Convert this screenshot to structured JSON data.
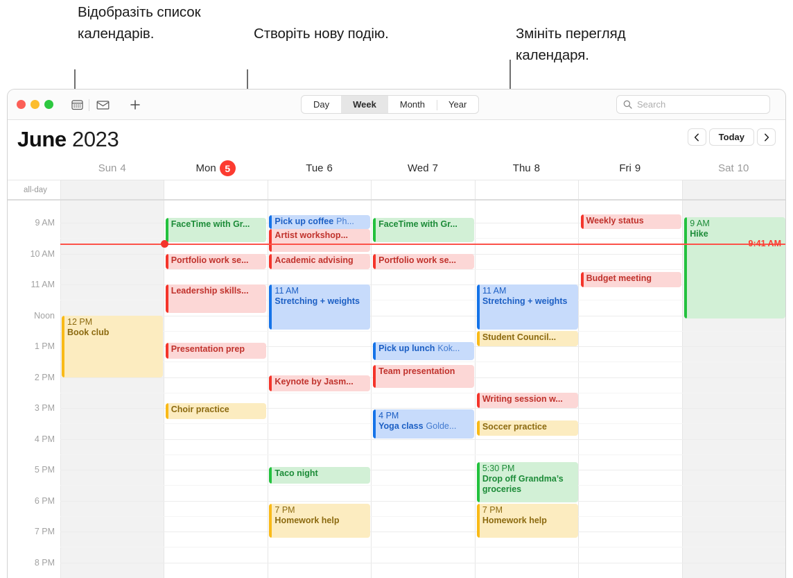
{
  "callouts": [
    {
      "id": "show-calendar-list",
      "text": "Відобразіть список календарів."
    },
    {
      "id": "create-new-event",
      "text": "Створіть нову подію."
    },
    {
      "id": "change-calendar-view",
      "text": "Змініть перегляд календаря."
    }
  ],
  "window": {
    "traffic_lights": [
      "close",
      "minimize",
      "zoom"
    ],
    "toolbar": {
      "calendar_list_icon": "calendar-icon",
      "inbox_icon": "inbox-icon",
      "new_event_icon": "plus-icon",
      "view_segments": [
        {
          "label": "Day",
          "active": false
        },
        {
          "label": "Week",
          "active": true
        },
        {
          "label": "Month",
          "active": false
        },
        {
          "label": "Year",
          "active": false
        }
      ],
      "search": {
        "icon": "search-icon",
        "placeholder": "Search",
        "value": ""
      }
    },
    "title": {
      "month": "June",
      "year": "2023"
    },
    "navigation": {
      "prev": "‹",
      "today": "Today",
      "next": "›"
    },
    "all_day_label": "all-day",
    "days": [
      {
        "weekday": "Sun",
        "date": "4",
        "today": false,
        "weekend": true
      },
      {
        "weekday": "Mon",
        "date": "5",
        "today": true,
        "weekend": false
      },
      {
        "weekday": "Tue",
        "date": "6",
        "today": false,
        "weekend": false
      },
      {
        "weekday": "Wed",
        "date": "7",
        "today": false,
        "weekend": false
      },
      {
        "weekday": "Thu",
        "date": "8",
        "today": false,
        "weekend": false
      },
      {
        "weekday": "Fri",
        "date": "9",
        "today": false,
        "weekend": false
      },
      {
        "weekday": "Sat",
        "date": "10",
        "today": false,
        "weekend": true
      }
    ],
    "time_labels": [
      "9 AM",
      "10 AM",
      "11 AM",
      "Noon",
      "1 PM",
      "2 PM",
      "3 PM",
      "4 PM",
      "5 PM",
      "6 PM",
      "7 PM",
      "8 PM"
    ],
    "current_time": "9:41 AM",
    "events": [
      {
        "day": 0,
        "color": "yellow",
        "time": "12 PM",
        "title": "Book club",
        "loc": "",
        "top": 0,
        "height": 0
      },
      {
        "day": 1,
        "color": "green",
        "time": "",
        "title": "FaceTime with Gr...",
        "loc": ""
      },
      {
        "day": 1,
        "color": "red",
        "time": "",
        "title": "Portfolio work se...",
        "loc": ""
      },
      {
        "day": 1,
        "color": "red",
        "time": "",
        "title": "Leadership skills...",
        "loc": ""
      },
      {
        "day": 1,
        "color": "red",
        "time": "",
        "title": "Presentation prep",
        "loc": ""
      },
      {
        "day": 1,
        "color": "yellow",
        "time": "",
        "title": "Choir practice",
        "loc": ""
      },
      {
        "day": 2,
        "color": "blue",
        "time": "",
        "title": "Pick up coffee",
        "loc": "Ph..."
      },
      {
        "day": 2,
        "color": "red",
        "time": "",
        "title": "Artist workshop...",
        "loc": ""
      },
      {
        "day": 2,
        "color": "red",
        "time": "",
        "title": "Academic advising",
        "loc": ""
      },
      {
        "day": 2,
        "color": "blue",
        "time": "11 AM",
        "title": "Stretching + weights",
        "loc": ""
      },
      {
        "day": 2,
        "color": "red",
        "time": "",
        "title": "Keynote by Jasm...",
        "loc": ""
      },
      {
        "day": 2,
        "color": "green",
        "time": "",
        "title": "Taco night",
        "loc": ""
      },
      {
        "day": 2,
        "color": "yellow",
        "time": "7 PM",
        "title": "Homework help",
        "loc": ""
      },
      {
        "day": 3,
        "color": "green",
        "time": "",
        "title": "FaceTime with Gr...",
        "loc": ""
      },
      {
        "day": 3,
        "color": "red",
        "time": "",
        "title": "Portfolio work se...",
        "loc": ""
      },
      {
        "day": 3,
        "color": "blue",
        "time": "",
        "title": "Pick up lunch",
        "loc": "Kok..."
      },
      {
        "day": 3,
        "color": "red",
        "time": "",
        "title": "Team presentation",
        "loc": ""
      },
      {
        "day": 3,
        "color": "blue",
        "time": "4 PM",
        "title": "Yoga class",
        "loc": "Golde..."
      },
      {
        "day": 4,
        "color": "blue",
        "time": "11 AM",
        "title": "Stretching + weights",
        "loc": ""
      },
      {
        "day": 4,
        "color": "yellow",
        "time": "",
        "title": "Student Council...",
        "loc": ""
      },
      {
        "day": 4,
        "color": "red",
        "time": "",
        "title": "Writing session w...",
        "loc": ""
      },
      {
        "day": 4,
        "color": "yellow",
        "time": "",
        "title": "Soccer practice",
        "loc": ""
      },
      {
        "day": 4,
        "color": "green",
        "time": "5:30 PM",
        "title": "Drop off Grandma’s groceries",
        "loc": ""
      },
      {
        "day": 4,
        "color": "yellow",
        "time": "7 PM",
        "title": "Homework help",
        "loc": ""
      },
      {
        "day": 5,
        "color": "red",
        "time": "",
        "title": "Weekly status",
        "loc": ""
      },
      {
        "day": 5,
        "color": "red",
        "time": "",
        "title": "Budget meeting",
        "loc": ""
      },
      {
        "day": 6,
        "color": "green",
        "time": "9 AM",
        "title": "Hike",
        "loc": ""
      }
    ]
  }
}
